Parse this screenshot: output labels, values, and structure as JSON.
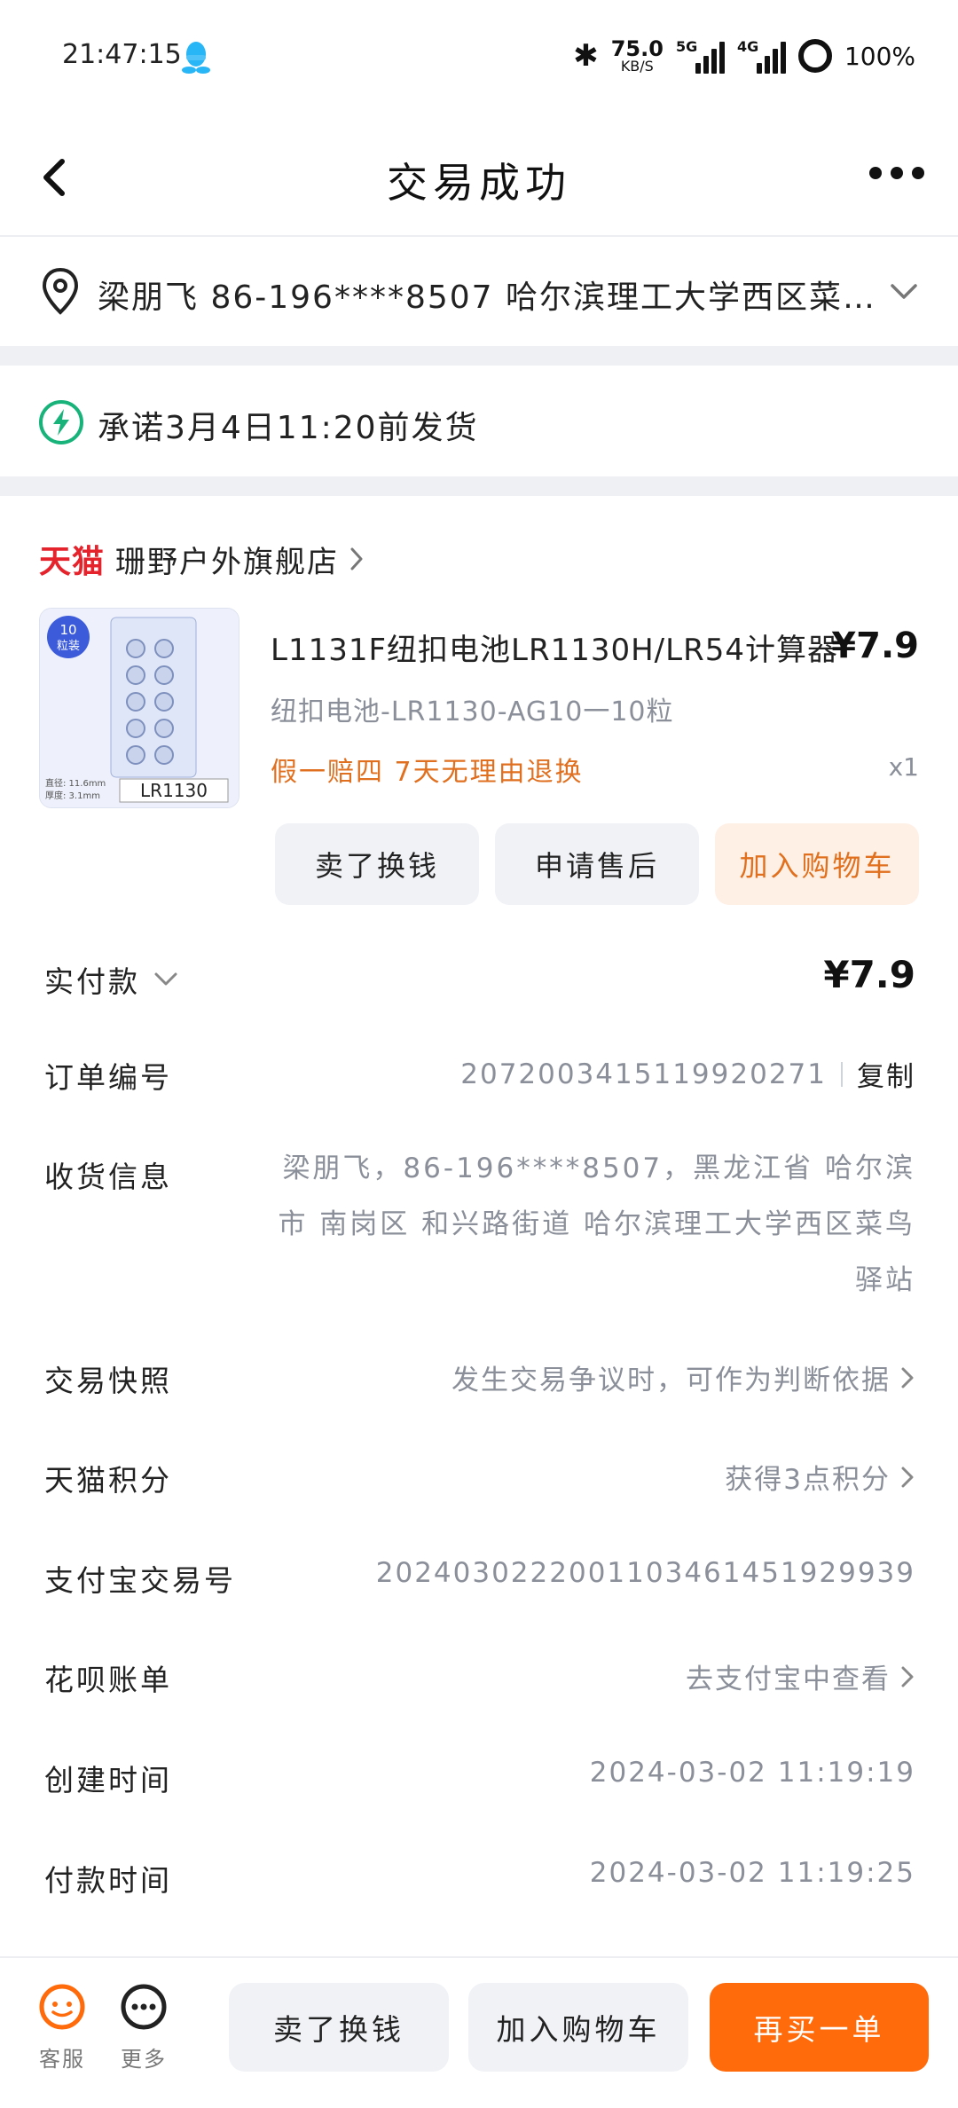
{
  "status_bar": {
    "time": "21:47:15",
    "net_speed": "75.0",
    "net_unit": "KB/S",
    "sim1": "5G",
    "sim2": "4G",
    "battery": "100%"
  },
  "nav": {
    "title": "交易成功"
  },
  "address": {
    "summary": "梁朋飞 86-196****8507 哈尔滨理工大学西区菜鸟驿站"
  },
  "shipping_promise": "承诺3月4日11:20前发货",
  "shop": {
    "platform": "天猫",
    "name": "珊野户外旗舰店"
  },
  "product": {
    "image_badge_count": "10",
    "image_badge_unit": "粒装",
    "image_model": "LR1130",
    "image_spec_1": "直径: 11.6mm",
    "image_spec_2": "厚度: 3.1mm",
    "title": "L1131F纽扣电池LR1130H/LR54计算器",
    "price": "¥7.9",
    "sku": "纽扣电池-LR1130-AG10一10粒",
    "tags": "假一赔四  7天无理由退换",
    "qty": "x1",
    "actions": [
      "卖了换钱",
      "申请售后",
      "加入购物车"
    ]
  },
  "details": {
    "paid_label": "实付款",
    "paid_value": "¥7.9",
    "order_no_label": "订单编号",
    "order_no_value": "2072003415119920271",
    "copy_label": "复制",
    "receiver_label": "收货信息",
    "receiver_value": "梁朋飞，86-196****8507，黑龙江省 哈尔滨市 南岗区 和兴路街道 哈尔滨理工大学西区菜鸟驿站",
    "snapshot_label": "交易快照",
    "snapshot_value": "发生交易争议时，可作为判断依据",
    "points_label": "天猫积分",
    "points_value": "获得3点积分",
    "alipay_label": "支付宝交易号",
    "alipay_value": "2024030222001103461451929939",
    "huabei_label": "花呗账单",
    "huabei_value": "去支付宝中查看",
    "created_label": "创建时间",
    "created_value": "2024-03-02 11:19:19",
    "paytime_label": "付款时间",
    "paytime_value": "2024-03-02 11:19:25"
  },
  "bottom": {
    "service_label": "客服",
    "more_label": "更多",
    "sell_label": "卖了换钱",
    "cart_label": "加入购物车",
    "rebuy_label": "再买一单"
  },
  "colors": {
    "accent": "#ff6a0b",
    "tmall_red": "#e5232c",
    "tag_orange": "#e07020",
    "bolt_green": "#18b37a"
  }
}
